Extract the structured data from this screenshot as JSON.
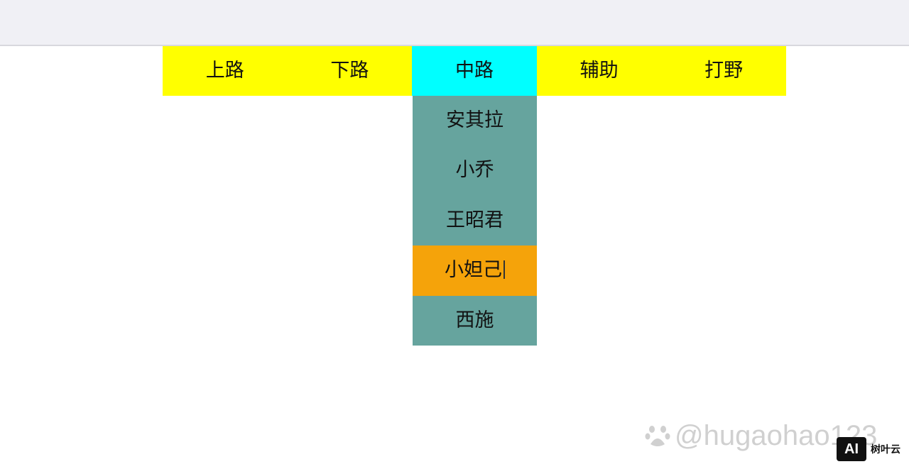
{
  "nav": {
    "items": [
      {
        "label": "上路"
      },
      {
        "label": "下路"
      },
      {
        "label": "中路"
      },
      {
        "label": "辅助"
      },
      {
        "label": "打野"
      }
    ],
    "active_index": 2
  },
  "dropdown": {
    "items": [
      {
        "label": "安其拉"
      },
      {
        "label": "小乔"
      },
      {
        "label": "王昭君"
      },
      {
        "label": "小妲己"
      },
      {
        "label": "西施"
      }
    ],
    "hovered_index": 3
  },
  "watermark": {
    "text": "@hugaohao123",
    "icon": "baidu-paw-icon"
  },
  "brand": {
    "logo_text": "AI",
    "name": "树叶云"
  },
  "colors": {
    "nav_bg": "#ffff00",
    "nav_active_bg": "#00ffff",
    "dropdown_bg": "#66a49e",
    "dropdown_hover_bg": "#f5a30a"
  }
}
